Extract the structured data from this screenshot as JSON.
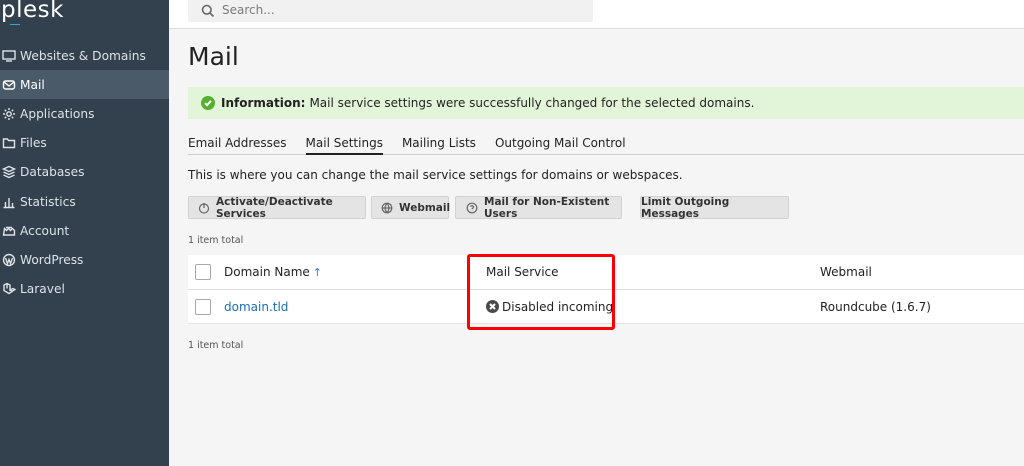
{
  "app": {
    "logo": "plesk"
  },
  "sidebar": {
    "items": [
      {
        "label": "Websites & Domains",
        "icon": "monitor-icon"
      },
      {
        "label": "Mail",
        "icon": "envelope-icon",
        "active": true
      },
      {
        "label": "Applications",
        "icon": "gear-icon"
      },
      {
        "label": "Files",
        "icon": "folder-icon"
      },
      {
        "label": "Databases",
        "icon": "database-icon"
      },
      {
        "label": "Statistics",
        "icon": "bar-chart-icon"
      },
      {
        "label": "Account",
        "icon": "account-icon"
      },
      {
        "label": "WordPress",
        "icon": "wordpress-icon"
      },
      {
        "label": "Laravel",
        "icon": "laravel-icon"
      }
    ]
  },
  "search": {
    "placeholder": "Search..."
  },
  "page": {
    "title": "Mail",
    "alert": {
      "label": "Information:",
      "message": "Mail service settings were successfully changed for the selected domains.",
      "color": "#e3f5d9"
    },
    "tabs": [
      {
        "label": "Email Addresses"
      },
      {
        "label": "Mail Settings",
        "active": true
      },
      {
        "label": "Mailing Lists"
      },
      {
        "label": "Outgoing Mail Control"
      }
    ],
    "description": "This is where you can change the mail service settings for domains or webspaces.",
    "toolbar": {
      "activate_label": "Activate/Deactivate Services",
      "webmail_label": "Webmail",
      "nonexistent_label": "Mail for Non-Existent Users",
      "limit_label": "Limit Outgoing Messages"
    },
    "total_top": "1 item total",
    "total_bottom": "1 item total"
  },
  "table": {
    "columns": {
      "domain": "Domain Name",
      "sort_indicator": "↑",
      "mail_service": "Mail Service",
      "webmail": "Webmail"
    },
    "rows": [
      {
        "domain": "domain.tld",
        "mail_service": "Disabled incoming",
        "webmail": "Roundcube (1.6.7)"
      }
    ]
  },
  "colors": {
    "sidebar": "#33404d",
    "accent": "#28aade",
    "highlight": "#ff0000",
    "link": "#1a6fb0"
  }
}
